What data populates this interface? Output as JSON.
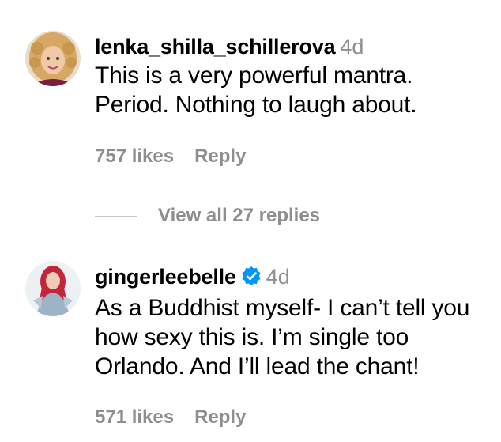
{
  "comments": [
    {
      "username": "lenka_shilla_schillerova",
      "time": "4d",
      "verified": false,
      "text": "This is a very powerful mantra. Period. Nothing to laugh about.",
      "likes": "757 likes",
      "reply_label": "Reply"
    },
    {
      "username": "gingerleebelle",
      "time": "4d",
      "verified": true,
      "text": "As a Buddhist myself- I can’t tell you how sexy this is. I’m single too Orlando. And I’ll lead the chant!",
      "likes": "571 likes",
      "reply_label": "Reply"
    }
  ],
  "view_replies_label": "View all 27 replies",
  "colors": {
    "text": "#000000",
    "secondary": "#8e8e8e",
    "verified": "#0095f6",
    "divider": "#c7c7c7"
  },
  "icons": {
    "verified": "verified-badge-icon"
  }
}
